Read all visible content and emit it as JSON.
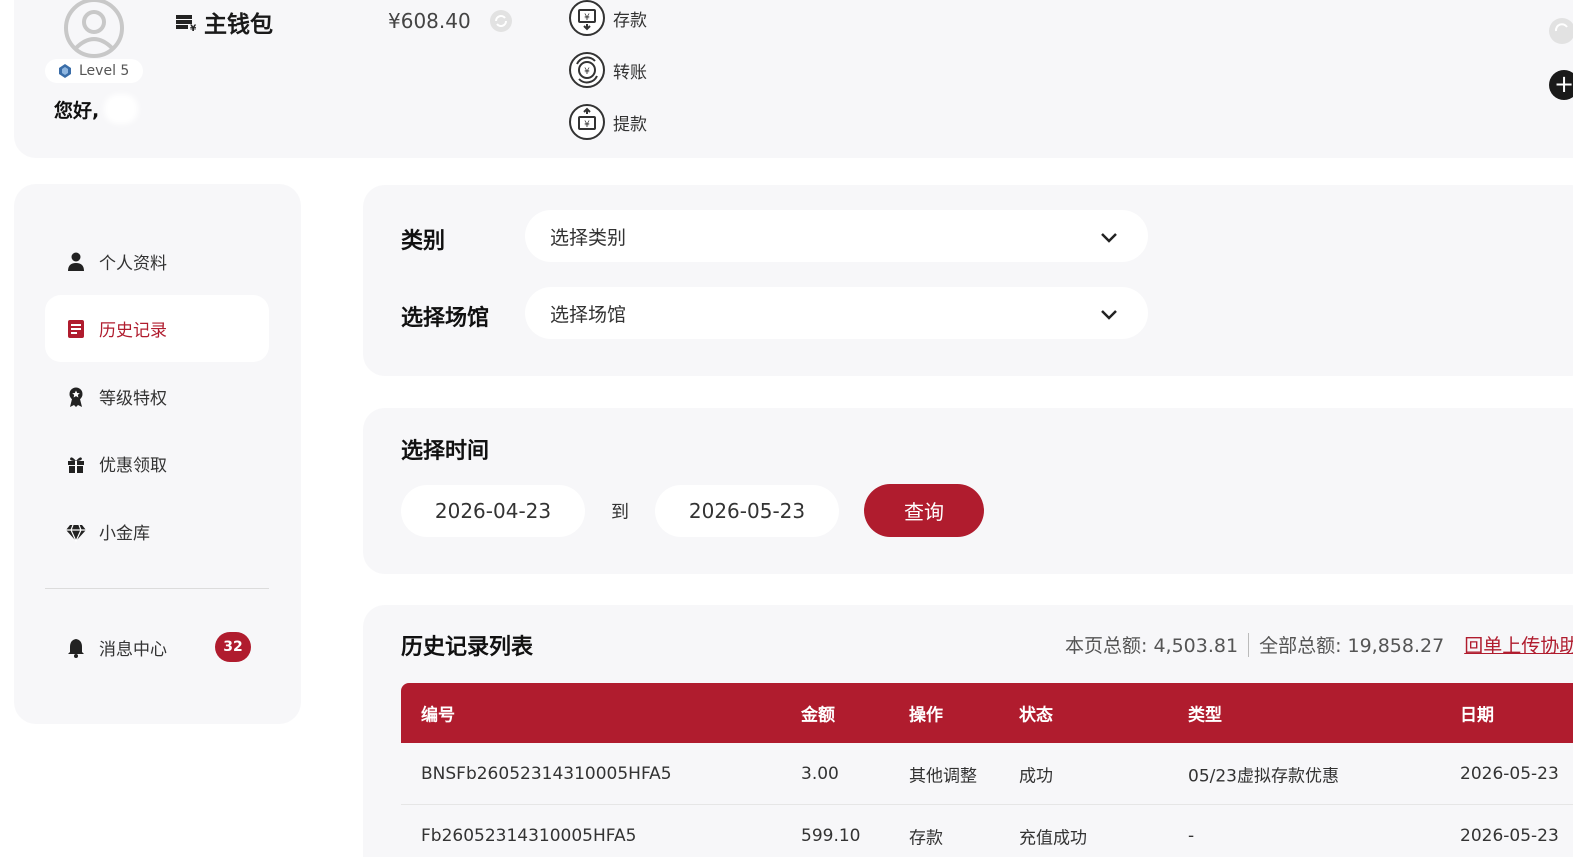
{
  "wallet": {
    "level": "Level 5",
    "greeting": "您好, ",
    "title": "主钱包",
    "balance": "¥608.40",
    "actions": [
      {
        "label": "存款",
        "icon": "deposit-icon"
      },
      {
        "label": "转账",
        "icon": "transfer-icon"
      },
      {
        "label": "提款",
        "icon": "withdraw-icon"
      }
    ]
  },
  "sidebar": {
    "items": [
      {
        "label": "个人资料",
        "icon": "user-icon"
      },
      {
        "label": "历史记录",
        "icon": "history-icon",
        "active": true
      },
      {
        "label": "等级特权",
        "icon": "medal-icon"
      },
      {
        "label": "优惠领取",
        "icon": "gift-icon"
      },
      {
        "label": "小金库",
        "icon": "diamond-icon"
      }
    ],
    "messages": {
      "label": "消息中心",
      "icon": "bell-icon",
      "count": "32"
    }
  },
  "filters": {
    "category_label": "类别",
    "category_placeholder": "选择类别",
    "venue_label": "选择场馆",
    "venue_placeholder": "选择场馆"
  },
  "time": {
    "title": "选择时间",
    "from": "2026-04-23",
    "to_label": "到",
    "to": "2026-05-23",
    "query_label": "查询"
  },
  "history": {
    "title": "历史记录列表",
    "page_total": "本页总额: 4,503.81",
    "all_total": "全部总额: 19,858.27",
    "upload_link": "回单上传协助",
    "columns": [
      "编号",
      "金额",
      "操作",
      "状态",
      "类型",
      "日期"
    ],
    "rows": [
      [
        "BNSFb26052314310005HFA5",
        "3.00",
        "其他调整",
        "成功",
        "05/23虚拟存款优惠",
        "2026-05-23"
      ],
      [
        "Fb26052314310005HFA5",
        "599.10",
        "存款",
        "充值成功",
        "-",
        "2026-05-23"
      ]
    ]
  },
  "colors": {
    "accent": "#b01c2e",
    "panel": "#f7f7f9"
  }
}
